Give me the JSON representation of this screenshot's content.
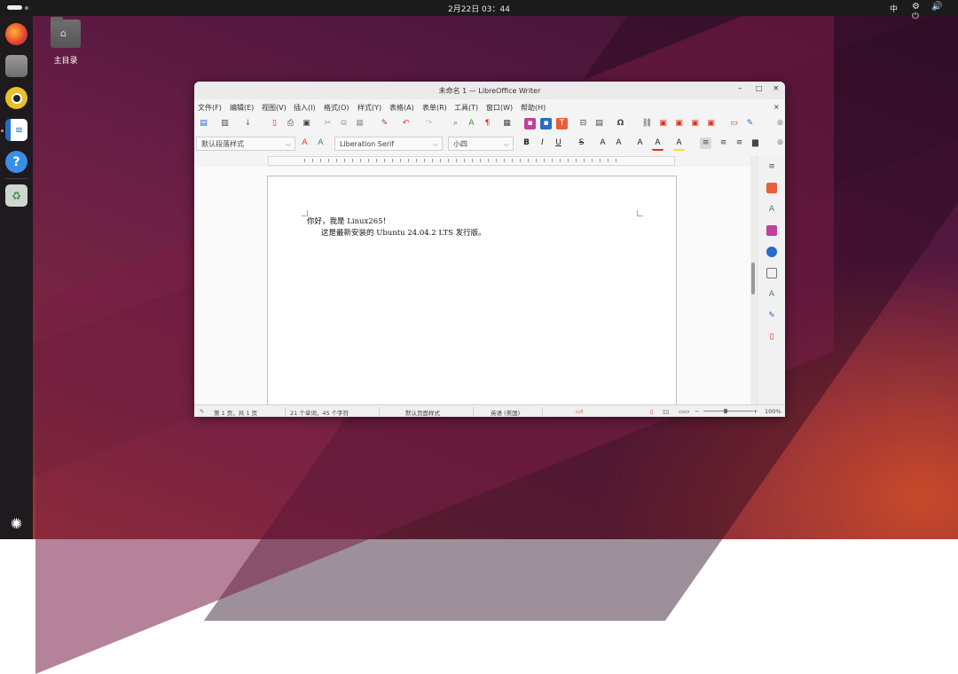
{
  "topbar": {
    "clock": "2月22日  03：44",
    "ime": "中",
    "tray_icons": "⚙ 🔊 ⏻"
  },
  "dock": {
    "items": [
      "firefox-icon",
      "files-icon",
      "rhythmbox-icon",
      "writer-icon",
      "help-icon",
      "trash-icon",
      "ubuntu-logo-icon"
    ]
  },
  "desktop": {
    "home_label": "主目录"
  },
  "window": {
    "title": "未命名 1 — LibreOffice Writer",
    "controls": {
      "minimize": "–",
      "maximize": "□",
      "close": "×"
    },
    "menu": [
      "文件(F)",
      "编辑(E)",
      "视图(V)",
      "插入(I)",
      "格式(O)",
      "样式(Y)",
      "表格(A)",
      "表单(R)",
      "工具(T)",
      "窗口(W)",
      "帮助(H)"
    ],
    "menu_close": "×",
    "format": {
      "paragraph_style": "默认段落样式",
      "font_name": "Liberation Serif",
      "font_size": "小四"
    },
    "document": {
      "line1": "你好，我是 Linux265！",
      "line2": "这是最新安装的 Ubuntu 24.04.2 LTS 发行版。"
    },
    "status": {
      "page": "第 1 页，共 1 页",
      "words": "21 个单词，45 个字符",
      "page_style": "默认页面样式",
      "language": "英语 (美国)",
      "zoom": "100%"
    }
  },
  "colors": {
    "accent_red": "#e0301e",
    "toolbar_blue": "#2a6ac8"
  }
}
